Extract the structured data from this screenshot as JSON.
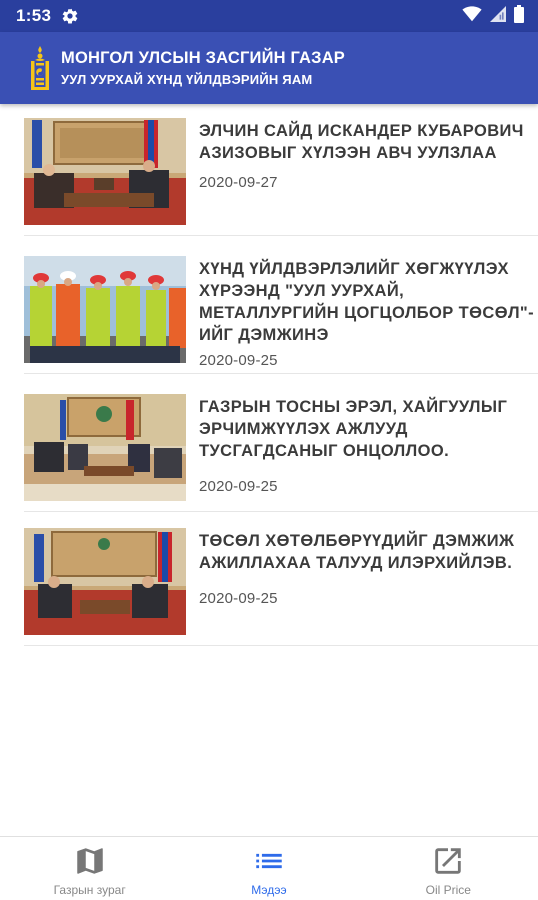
{
  "status_bar": {
    "time": "1:53",
    "icons": [
      "gear-icon",
      "wifi-icon",
      "signal-icon",
      "battery-icon"
    ]
  },
  "header": {
    "title": "МОНГОЛ УЛСЫН ЗАСГИЙН ГАЗАР",
    "subtitle": "УУЛ УУРХАЙ ХҮНД ҮЙЛДВЭРИЙН ЯАМ",
    "logo_icon": "soyombo-emblem-icon",
    "color": "#3a50b4"
  },
  "news": [
    {
      "title": "ЭЛЧИН САЙД ИСКАНДЕР КУБАРОВИЧ АЗИЗОВЫГ ХҮЛЭЭН АВЧ УУЛЗЛАА",
      "date": "2020-09-27",
      "image": "meeting-with-flags"
    },
    {
      "title": "ХҮНД ҮЙЛДВЭРЛЭЛИЙГ ХӨГЖҮҮЛЭХ ХҮРЭЭНД \"УУЛ УУРХАЙ, МЕТАЛЛУРГИЙН ЦОГЦОЛБОР ТӨСӨЛ\"-ИЙГ ДЭМЖИНЭ",
      "date": "2020-09-25",
      "image": "workers-in-hardhats"
    },
    {
      "title": "ГАЗРЫН ТОСНЫ ЭРЭЛ, ХАЙГУУЛЫГ ЭРЧИМЖҮҮЛЭХ АЖЛУУД ТУСГАГДСАНЫГ ОНЦОЛЛОО.",
      "date": "2020-09-25",
      "image": "conference-room-meeting"
    },
    {
      "title": "ТӨСӨЛ ХӨТӨЛБӨРҮҮДИЙГ ДЭМЖИЖ АЖИЛЛАХАА ТАЛУУД ИЛЭРХИЙЛЭВ.",
      "date": "2020-09-25",
      "image": "meeting-with-flags"
    }
  ],
  "bottom_nav": [
    {
      "label": "Газрын зураг",
      "icon": "map-icon",
      "active": false
    },
    {
      "label": "Мэдээ",
      "icon": "list-icon",
      "active": true
    },
    {
      "label": "Oil Price",
      "icon": "open-external-icon",
      "active": false
    }
  ],
  "colors": {
    "status_bar": "#2a3f9e",
    "accent": "#2e6bea",
    "inactive": "#888888"
  }
}
